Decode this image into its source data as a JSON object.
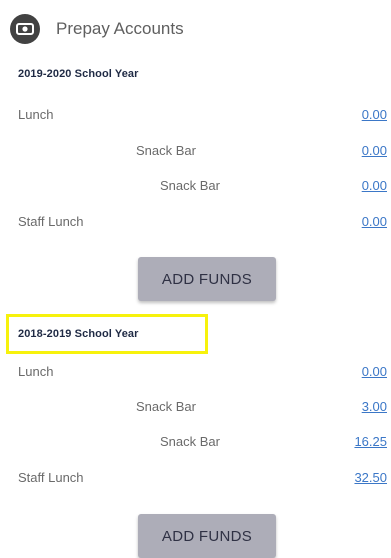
{
  "header": {
    "title": "Prepay Accounts"
  },
  "sections": [
    {
      "year": "2019-2020 School Year",
      "rows": [
        {
          "label": "Lunch",
          "amount": "0.00"
        },
        {
          "label": "Snack Bar",
          "amount": "0.00"
        },
        {
          "label": "Snack Bar",
          "amount": "0.00"
        },
        {
          "label": "Staff Lunch",
          "amount": "0.00"
        }
      ],
      "button": "ADD FUNDS"
    },
    {
      "year": "2018-2019 School Year",
      "rows": [
        {
          "label": "Lunch",
          "amount": "0.00"
        },
        {
          "label": "Snack Bar",
          "amount": "3.00"
        },
        {
          "label": "Snack Bar",
          "amount": "16.25"
        },
        {
          "label": "Staff Lunch",
          "amount": "32.50"
        }
      ],
      "button": "ADD FUNDS"
    }
  ],
  "colors": {
    "link": "#3b77c7",
    "highlight": "#f7f20c",
    "button": "#adadb8"
  }
}
